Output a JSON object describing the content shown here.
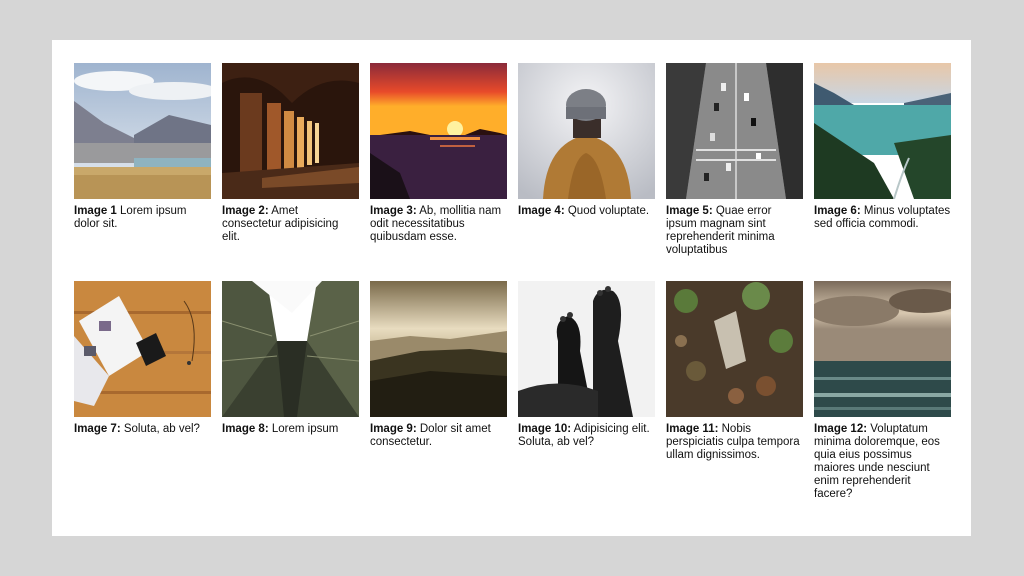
{
  "gallery": {
    "items": [
      {
        "label": "Image 1",
        "text": " Lorem ipsum dolor sit.",
        "image": "mountain-lake-landscape"
      },
      {
        "label": "Image 2:",
        "text": " Amet consectetur adipisicing elit.",
        "image": "arched-corridor"
      },
      {
        "label": "Image 3:",
        "text": " Ab, mollitia nam odit necessitatibus quibusdam esse.",
        "image": "sunset-over-sea"
      },
      {
        "label": "Image 4:",
        "text": " Quod voluptate.",
        "image": "person-in-beanie"
      },
      {
        "label": "Image 5:",
        "text": " Quae error ipsum magnam sint reprehenderit minima voluptatibus",
        "image": "aerial-highway-traffic"
      },
      {
        "label": "Image 6:",
        "text": " Minus voluptates sed officia commodi.",
        "image": "forest-lake-valley"
      },
      {
        "label": "Image 7:",
        "text": " Soluta, ab vel?",
        "image": "magazine-on-wooden-desk"
      },
      {
        "label": "Image 8:",
        "text": " Lorem ipsum",
        "image": "skyscrapers-looking-up"
      },
      {
        "label": "Image 9:",
        "text": " Dolor sit amet consectetur.",
        "image": "hazy-hills-sunrise"
      },
      {
        "label": "Image 10:",
        "text": " Adipisicing elit. Soluta, ab vel?",
        "image": "bare-feet-black-and-white"
      },
      {
        "label": "Image 11:",
        "text": " Nobis perspiciatis culpa tempora ullam dignissimos.",
        "image": "leaves-on-ground"
      },
      {
        "label": "Image 12:",
        "text": " Voluptatum minima doloremque, eos quia eius possimus maiores unde nesciunt enim reprehenderit facere?",
        "image": "stormy-sea-clouds"
      }
    ]
  }
}
